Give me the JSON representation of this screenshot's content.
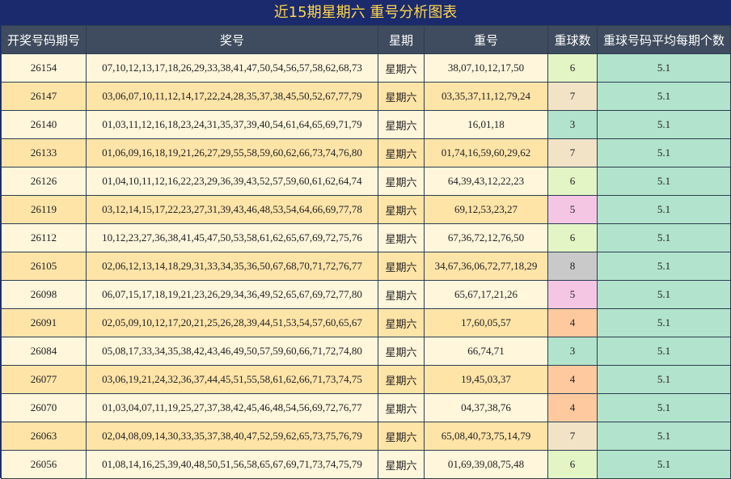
{
  "title": "近15期星期六 重号分析图表",
  "headers": [
    "开奖号码期号",
    "奖号",
    "星期",
    "重号",
    "重球数",
    "重球号码平均每期个数"
  ],
  "colors": {
    "3": "#b2e3cc",
    "4": "#ffc9a0",
    "5": "#f5c6e4",
    "6": "#e3f5c5",
    "7": "#f2e3c7",
    "8": "#c9c9c9"
  },
  "rows": [
    {
      "period": "26154",
      "numbers": "07,10,12,13,17,18,26,29,33,38,41,47,50,54,56,57,58,62,68,73",
      "weekday": "星期六",
      "repeat": "38,07,10,12,17,50",
      "count": "6",
      "avg": "5.1"
    },
    {
      "period": "26147",
      "numbers": "03,06,07,10,11,12,14,17,22,24,28,35,37,38,45,50,52,67,77,79",
      "weekday": "星期六",
      "repeat": "03,35,37,11,12,79,24",
      "count": "7",
      "avg": "5.1"
    },
    {
      "period": "26140",
      "numbers": "01,03,11,12,16,18,23,24,31,35,37,39,40,54,61,64,65,69,71,79",
      "weekday": "星期六",
      "repeat": "16,01,18",
      "count": "3",
      "avg": "5.1"
    },
    {
      "period": "26133",
      "numbers": "01,06,09,16,18,19,21,26,27,29,55,58,59,60,62,66,73,74,76,80",
      "weekday": "星期六",
      "repeat": "01,74,16,59,60,29,62",
      "count": "7",
      "avg": "5.1"
    },
    {
      "period": "26126",
      "numbers": "01,04,10,11,12,16,22,23,29,36,39,43,52,57,59,60,61,62,64,74",
      "weekday": "星期六",
      "repeat": "64,39,43,12,22,23",
      "count": "6",
      "avg": "5.1"
    },
    {
      "period": "26119",
      "numbers": "03,12,14,15,17,22,23,27,31,39,43,46,48,53,54,64,66,69,77,78",
      "weekday": "星期六",
      "repeat": "69,12,53,23,27",
      "count": "5",
      "avg": "5.1"
    },
    {
      "period": "26112",
      "numbers": "10,12,23,27,36,38,41,45,47,50,53,58,61,62,65,67,69,72,75,76",
      "weekday": "星期六",
      "repeat": "67,36,72,12,76,50",
      "count": "6",
      "avg": "5.1"
    },
    {
      "period": "26105",
      "numbers": "02,06,12,13,14,18,29,31,33,34,35,36,50,67,68,70,71,72,76,77",
      "weekday": "星期六",
      "repeat": "34,67,36,06,72,77,18,29",
      "count": "8",
      "avg": "5.1"
    },
    {
      "period": "26098",
      "numbers": "06,07,15,17,18,19,21,23,26,29,34,36,49,52,65,67,69,72,77,80",
      "weekday": "星期六",
      "repeat": "65,67,17,21,26",
      "count": "5",
      "avg": "5.1"
    },
    {
      "period": "26091",
      "numbers": "02,05,09,10,12,17,20,21,25,26,28,39,44,51,53,54,57,60,65,67",
      "weekday": "星期六",
      "repeat": "17,60,05,57",
      "count": "4",
      "avg": "5.1"
    },
    {
      "period": "26084",
      "numbers": "05,08,17,33,34,35,38,42,43,46,49,50,57,59,60,66,71,72,74,80",
      "weekday": "星期六",
      "repeat": "66,74,71",
      "count": "3",
      "avg": "5.1"
    },
    {
      "period": "26077",
      "numbers": "03,06,19,21,24,32,36,37,44,45,51,55,58,61,62,66,71,73,74,75",
      "weekday": "星期六",
      "repeat": "19,45,03,37",
      "count": "4",
      "avg": "5.1"
    },
    {
      "period": "26070",
      "numbers": "01,03,04,07,11,19,25,27,37,38,42,45,46,48,54,56,69,72,76,77",
      "weekday": "星期六",
      "repeat": "04,37,38,76",
      "count": "4",
      "avg": "5.1"
    },
    {
      "period": "26063",
      "numbers": "02,04,08,09,14,30,33,35,37,38,40,47,52,59,62,65,73,75,76,79",
      "weekday": "星期六",
      "repeat": "65,08,40,73,75,14,79",
      "count": "7",
      "avg": "5.1"
    },
    {
      "period": "26056",
      "numbers": "01,08,14,16,25,39,40,48,50,51,56,58,65,67,69,71,73,74,75,79",
      "weekday": "星期六",
      "repeat": "01,69,39,08,75,48",
      "count": "6",
      "avg": "5.1"
    }
  ]
}
